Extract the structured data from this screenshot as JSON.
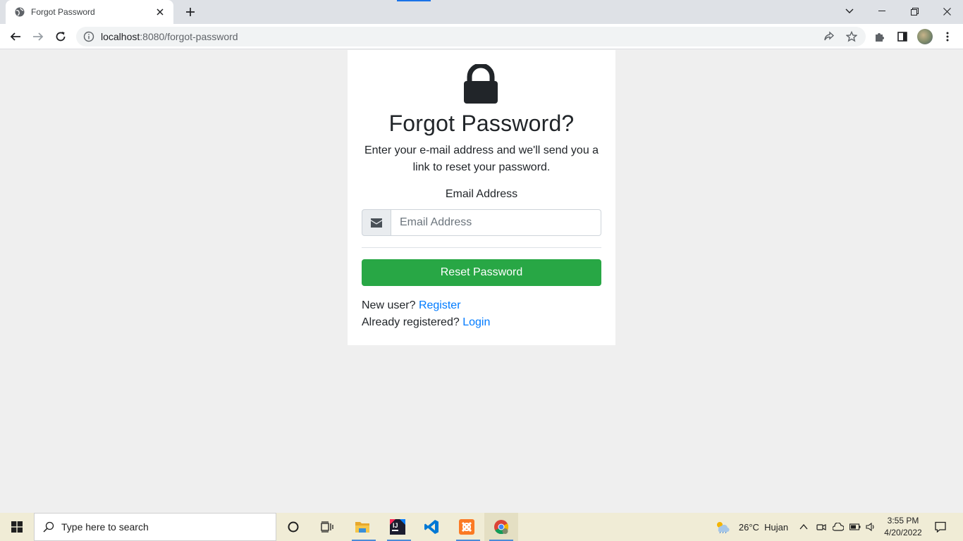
{
  "browser": {
    "tab_title": "Forgot Password",
    "url_host": "localhost",
    "url_rest": ":8080/forgot-password"
  },
  "page": {
    "title": "Forgot Password?",
    "description": "Enter your e-mail address and we'll send you a link to reset your password.",
    "email_label": "Email Address",
    "email_placeholder": "Email Address",
    "email_value": "",
    "reset_button": "Reset Password",
    "new_user_text": "New user?",
    "register_link": "Register",
    "already_registered_text": "Already registered?",
    "login_link": "Login"
  },
  "taskbar": {
    "search_placeholder": "Type here to search",
    "weather": "26°C  Hujan",
    "time": "3:55 PM",
    "date": "4/20/2022"
  },
  "colors": {
    "accent_green": "#28a745",
    "link_blue": "#007bff",
    "chrome_blue": "#1a73e8"
  }
}
